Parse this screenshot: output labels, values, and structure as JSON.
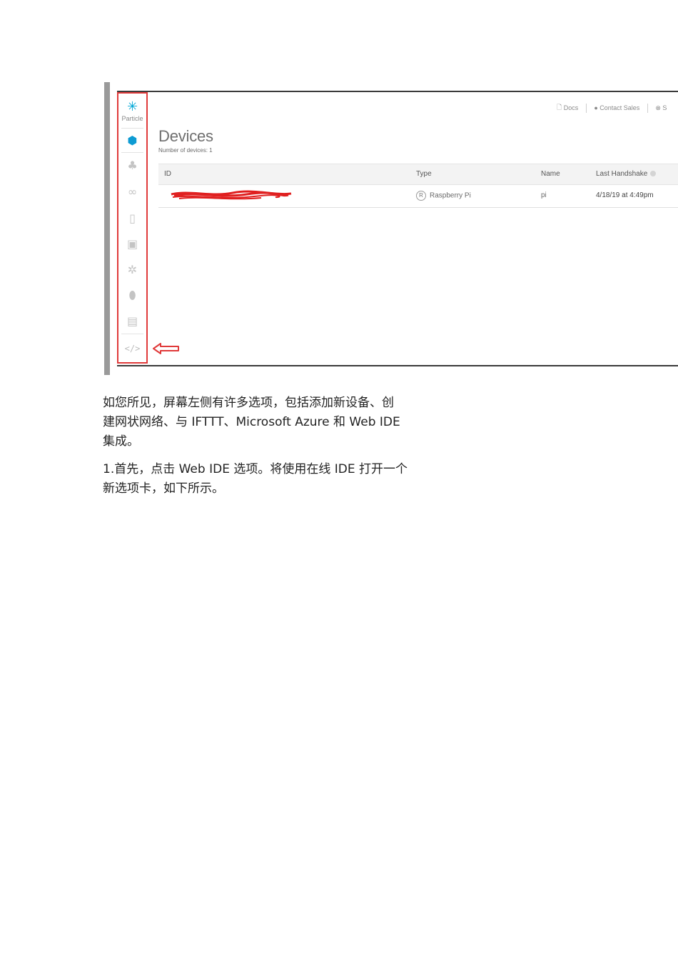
{
  "screenshot": {
    "brand": "Particle",
    "topnav": {
      "docs": "Docs",
      "contact_sales": "Contact Sales",
      "support_partial": "S"
    },
    "title": "Devices",
    "device_count": "Number of devices: 1",
    "table": {
      "headers": [
        "ID",
        "Type",
        "Name",
        "Last Handshake"
      ],
      "rows": [
        {
          "id": "",
          "type": "Raspberry Pi",
          "type_badge": "R",
          "name": "pi",
          "last_handshake": "4/18/19 at 4:49pm"
        }
      ]
    },
    "sidebar_icons": [
      "devices-cube-icon",
      "products-icon",
      "mesh-networks-icon",
      "sim-cards-icon",
      "console-icon",
      "integrations-icon",
      "authentication-icon",
      "billing-icon",
      "web-ide-code-icon"
    ],
    "colors": {
      "highlight": "#e03a3a",
      "accent": "#00a7d6"
    }
  },
  "text": {
    "para1_line1": "如您所见，屏幕左侧有许多选项，包括添加新设备、创",
    "para1_line2": "建网状网络、与 IFTTT、Microsoft Azure 和 Web IDE",
    "para1_line3": "集成。",
    "para2_line1": "1.首先，点击 Web IDE 选项。将使用在线 IDE 打开一个",
    "para2_line2": "新选项卡，如下所示。"
  }
}
